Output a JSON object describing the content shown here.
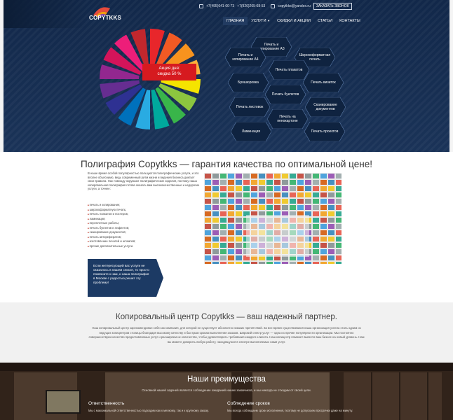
{
  "header": {
    "logo_text": "COPYTKKS",
    "phone1": "+7(495)641-00-73",
    "phone2": "+7(926)265-68-53",
    "email": "copytkks@yandex.ru",
    "callback_label": "ЗАКАЗАТЬ ЗВОНОК",
    "nav": [
      {
        "label": "ГЛАВНАЯ",
        "active": true
      },
      {
        "label": "УСЛУГИ",
        "has_dropdown": true
      },
      {
        "label": "СКИДКИ И АКЦИИ"
      },
      {
        "label": "СТАТЬИ"
      },
      {
        "label": "КОНТАКТЫ"
      }
    ]
  },
  "hero": {
    "promo_line1": "Акция дня:",
    "promo_line2": "скидка 50 %",
    "services": [
      "Печать и копирование А3",
      "Печать и копирование А4",
      "Широкоформатная печать",
      "Печать плакатов",
      "Брошюровка",
      "Печать визиток",
      "Печать буклетов",
      "Печать листовок",
      "Сканирование документов",
      "Печать на пенокартоне",
      "Ламинация",
      "Печать проектов"
    ]
  },
  "intro": {
    "title": "Полиграфия Copytkks — гарантия качества по оптимальной цене!",
    "paragraph": "В наше время особой популярностью пользуются полиграфические услуги, и это вполне объяснимо, ведь современный ритм жизни и ведения бизнеса диктует свои правила. Нас повсюду окружают полиграфические изделия, поэтому наша копировальная полиграфия готова оказать вам высококачественные и недорогие услуги, а точнее:",
    "list": [
      "печать и копирование;",
      "широкоформатную печать;",
      "печать плакатов и постеров;",
      "ламинация;",
      "переплетные работы;",
      "печать буклетов и лифлетов;",
      "сканирование документов;",
      "печать авторефератов;",
      "изготовление печатей и штампов;",
      "прочие дополнительные услуги."
    ],
    "callout": "Если интересующей вас услуги не оказалось в нашем списке, то просто позвоните к нам, и наша полиграфия в Москве с радостью решит эту проблему!"
  },
  "partner": {
    "title": "Копировальный центр Copytkks — ваш надежный партнер.",
    "text": "Наш копировальный центр зарекомендовал себя как компания, для которой не существует абсолютно никаких препятствий. За все время существования наша организация успела стать одним из ведущих копицентров столицы благодаря высокому качеству и быстрым срокам выполнения заказов. Широкий спектр услуг — одна из причин популярности организации. Мы постоянно совершенствуем качество предоставляемых услуг и расширяем их количество, чтобы удовлетворить требования каждого клиента. Наш копицентр поможет вывести ваш бизнес на новый уровень. Нам вы можете доверить любую работу, находящуюся в спектре выполняемых нами услуг."
  },
  "advantages": {
    "title": "Наши преимущества",
    "subtitle": "Основной нашей задачей является соблюдение ожиданий наших заказчиков, и мы никогда не отходим от своей цели.",
    "items": [
      {
        "title": "Ответственность",
        "text": "Мы с максимальной ответственностью подходим как к мелкому, так и к крупному заказу."
      },
      {
        "title": "Соблюдение сроков",
        "text": "Мы всегда соблюдаем сроки исполнения, поэтому не допускаем просрочки даже на минуту."
      }
    ]
  },
  "colors": {
    "navy": "#142a4a",
    "promo_red": "#d61a1f",
    "hex_fill": "#0f2340"
  }
}
